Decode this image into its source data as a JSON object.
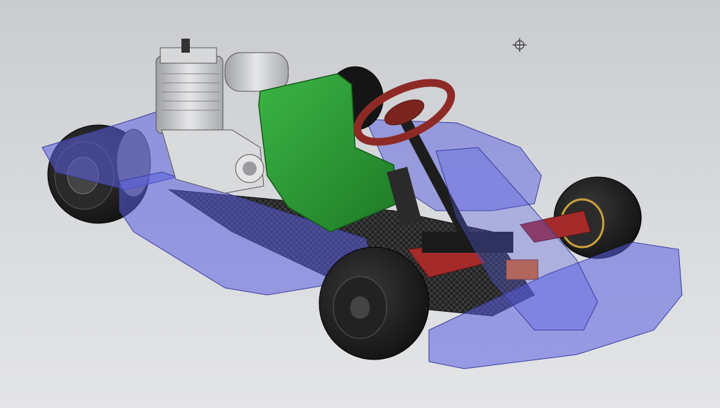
{
  "viewport": {
    "background_top": "#c9cbce",
    "background_bottom": "#e4e5e7"
  },
  "cursor": {
    "icon": "crosshair-cursor-icon"
  },
  "model": {
    "components": [
      {
        "id": "bodywork",
        "color": "#5a5fe0",
        "translucent": true
      },
      {
        "id": "seat",
        "color": "#2e9a35"
      },
      {
        "id": "steering-wheel",
        "color": "#8e2a26"
      },
      {
        "id": "engine",
        "color": "#c8c9cb"
      },
      {
        "id": "chassis-plate",
        "color": "#2b2b2b"
      },
      {
        "id": "tires",
        "color": "#1c1c1c"
      },
      {
        "id": "spindle-brackets",
        "color": "#a52a2a"
      },
      {
        "id": "brake-caliper",
        "color": "#e06a1a"
      },
      {
        "id": "rim-accent",
        "color": "#c9a03a"
      }
    ]
  }
}
